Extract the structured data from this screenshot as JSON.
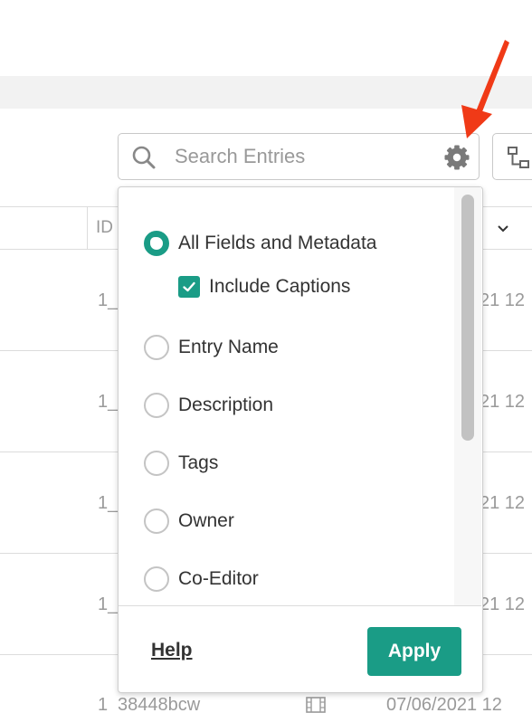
{
  "search": {
    "placeholder": "Search Entries"
  },
  "table": {
    "id_header": "ID",
    "rows": [
      {
        "id": "1_",
        "date": "21 12"
      },
      {
        "id": "1_",
        "date": "21 12"
      },
      {
        "id": "1_",
        "date": "21 12"
      },
      {
        "id": "1_",
        "date": "21 12"
      }
    ],
    "last_row": {
      "id": "1",
      "entry": "38448bcw",
      "date": "07/06/2021 12"
    }
  },
  "dropdown": {
    "options": [
      {
        "label": "All Fields and Metadata",
        "checked": true
      },
      {
        "label": "Entry Name",
        "checked": false
      },
      {
        "label": "Description",
        "checked": false
      },
      {
        "label": "Tags",
        "checked": false
      },
      {
        "label": "Owner",
        "checked": false
      },
      {
        "label": "Co-Editor",
        "checked": false
      }
    ],
    "include_captions": {
      "label": "Include Captions",
      "checked": true
    },
    "help_label": "Help",
    "apply_label": "Apply"
  },
  "colors": {
    "accent": "#1a9c86",
    "arrow": "#f03a17"
  },
  "icons": [
    "search-icon",
    "gear-icon",
    "hierarchy-icon",
    "chevron-down-icon",
    "film-icon",
    "checkmark-icon",
    "arrow-pointer"
  ]
}
